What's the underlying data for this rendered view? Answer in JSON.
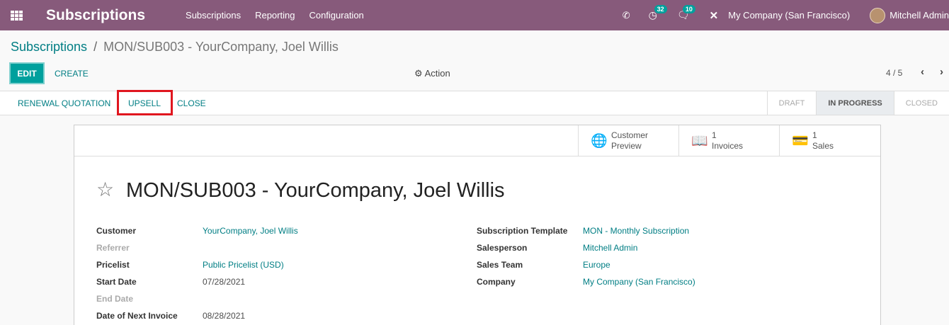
{
  "navbar": {
    "brand": "Subscriptions",
    "menu": [
      "Subscriptions",
      "Reporting",
      "Configuration"
    ],
    "activity_count": "32",
    "messages_count": "10",
    "company": "My Company (San Francisco)",
    "user": "Mitchell Admin"
  },
  "breadcrumb": {
    "parent": "Subscriptions",
    "separator": "/",
    "current": "MON/SUB003 - YourCompany, Joel Willis"
  },
  "controls": {
    "edit": "EDIT",
    "create": "CREATE",
    "action": "Action",
    "pager": "4 / 5"
  },
  "statusbar": {
    "buttons": [
      "RENEWAL QUOTATION",
      "UPSELL",
      "CLOSE"
    ],
    "stages": [
      "DRAFT",
      "IN PROGRESS",
      "CLOSED"
    ],
    "current_stage": "IN PROGRESS"
  },
  "smart_buttons": [
    {
      "line1": "Customer",
      "line2": "Preview",
      "icon": "globe-icon"
    },
    {
      "line1": "1",
      "line2": "Invoices",
      "icon": "book-icon"
    },
    {
      "line1": "1",
      "line2": "Sales",
      "icon": "credit-card-icon"
    }
  ],
  "record": {
    "title": "MON/SUB003 - YourCompany, Joel Willis",
    "left_fields": [
      {
        "label": "Customer",
        "value": "YourCompany, Joel Willis"
      },
      {
        "label": "Referrer",
        "value": ""
      },
      {
        "label": "Pricelist",
        "value": "Public Pricelist (USD)"
      },
      {
        "label": "Start Date",
        "value": "07/28/2021"
      },
      {
        "label": "End Date",
        "value": ""
      },
      {
        "label": "Date of Next Invoice",
        "value": "08/28/2021"
      }
    ],
    "right_fields": [
      {
        "label": "Subscription Template",
        "value": "MON - Monthly Subscription"
      },
      {
        "label": "Salesperson",
        "value": "Mitchell Admin"
      },
      {
        "label": "Sales Team",
        "value": "Europe"
      },
      {
        "label": "Company",
        "value": "My Company (San Francisco)"
      }
    ]
  },
  "colors": {
    "brand": "#875a7b",
    "primary": "#00a09d",
    "link": "#017e84",
    "highlight": "#e0161f"
  }
}
